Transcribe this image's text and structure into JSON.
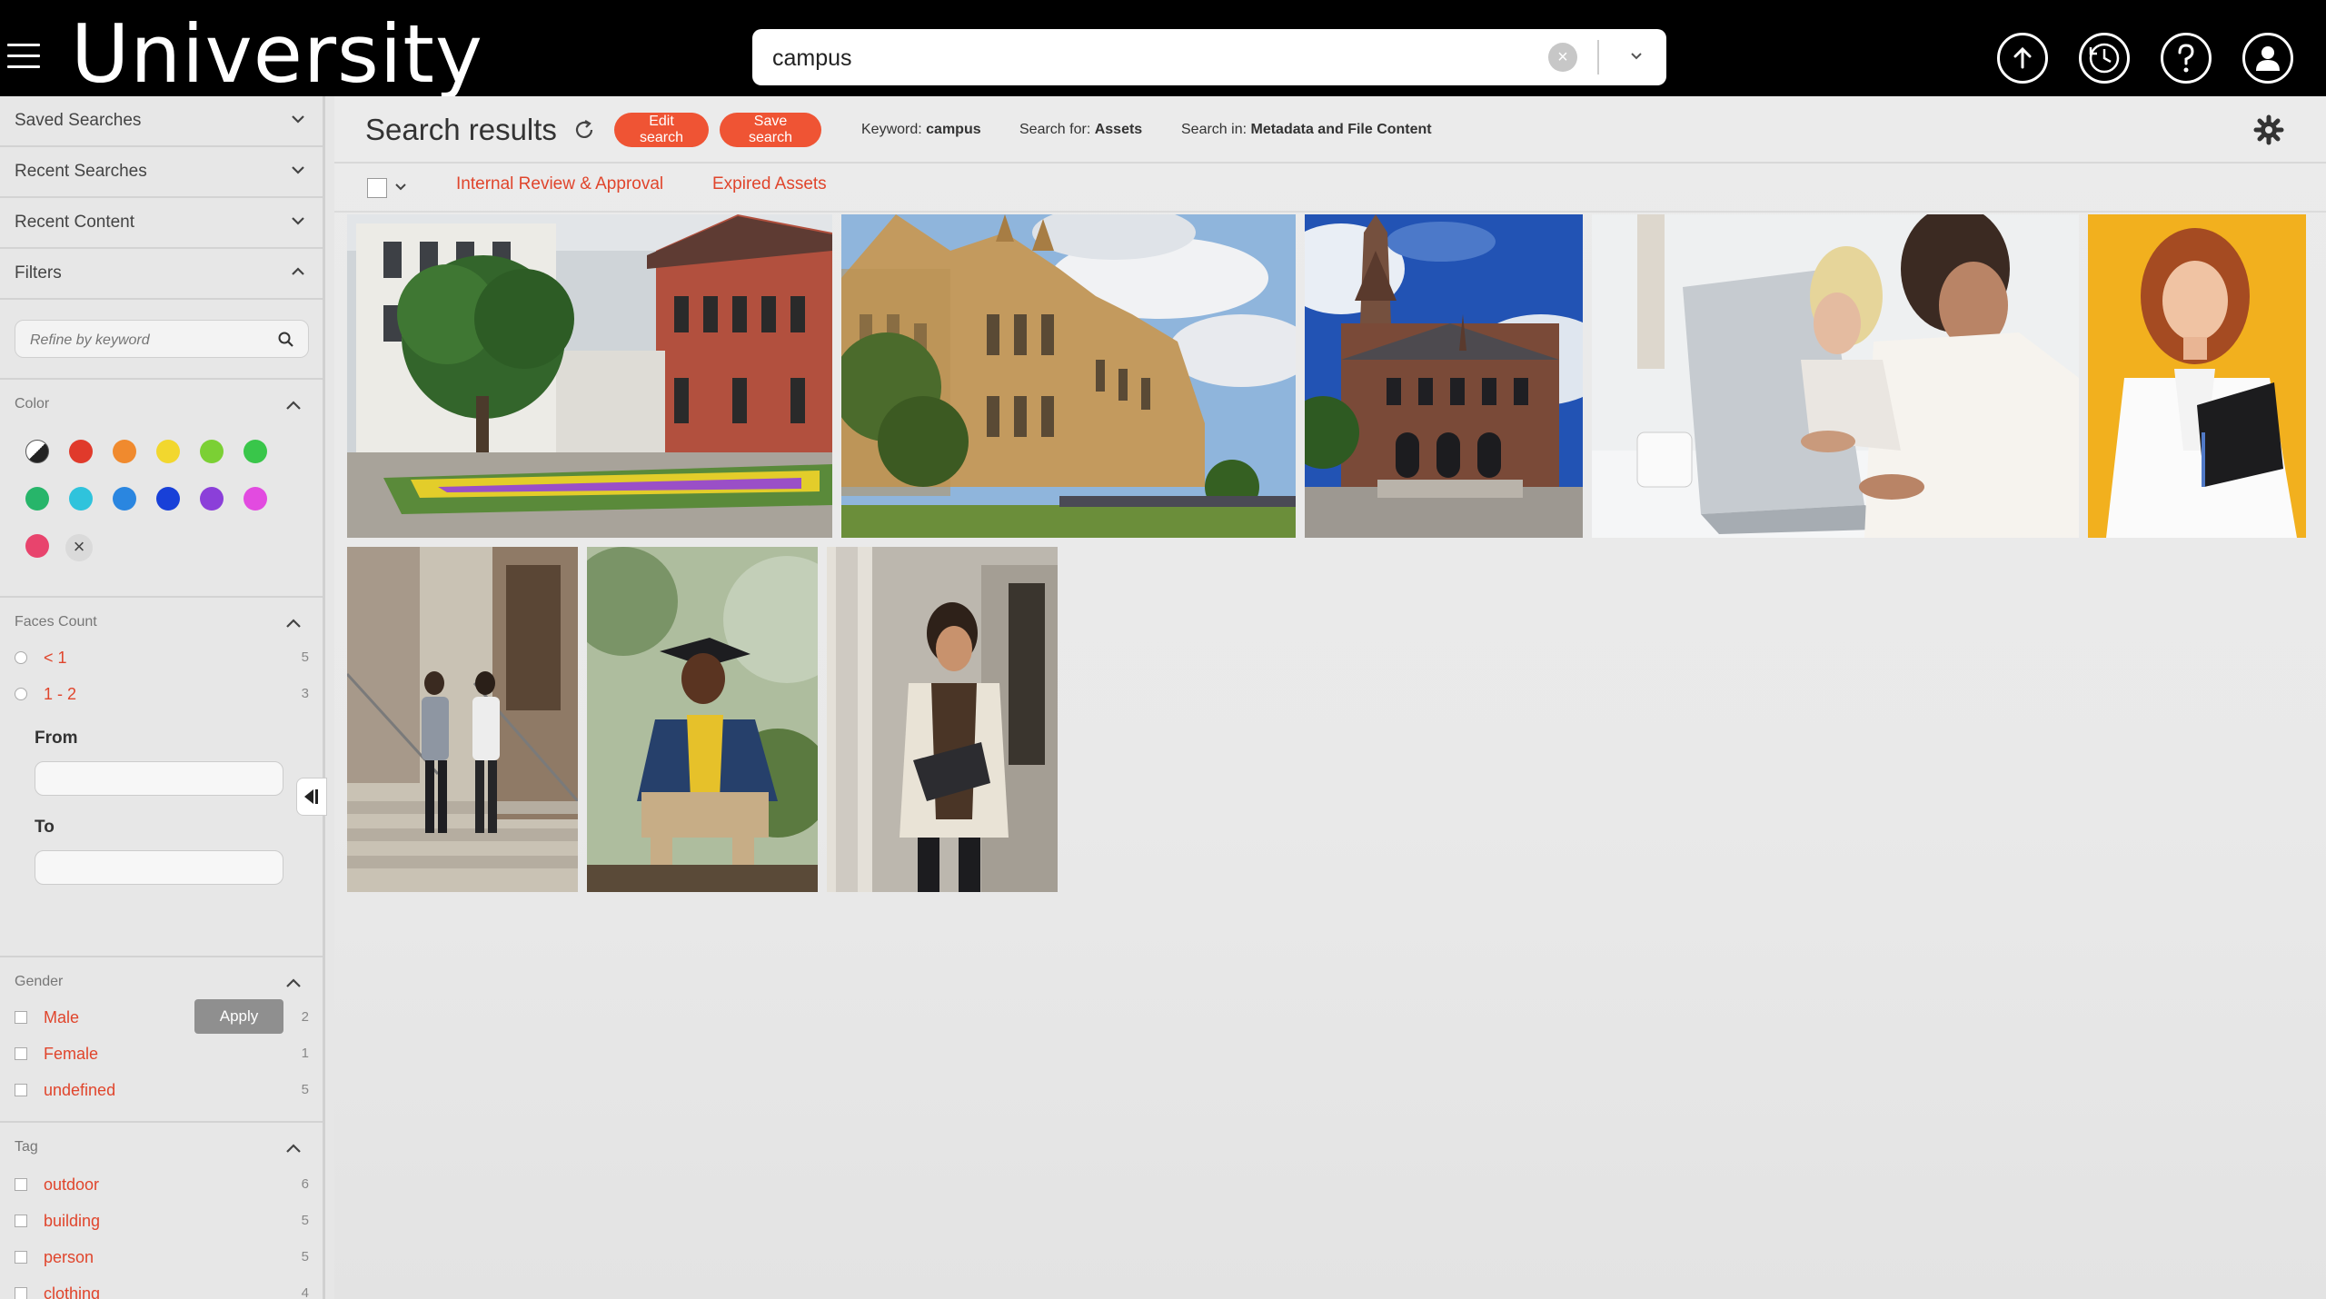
{
  "header": {
    "brand": "University",
    "search": {
      "value": "campus",
      "placeholder": ""
    },
    "icons": [
      "upload-icon",
      "history-icon",
      "help-icon",
      "user-icon"
    ]
  },
  "sidebar": {
    "sections": [
      {
        "label": "Saved Searches",
        "expanded": false
      },
      {
        "label": "Recent Searches",
        "expanded": false
      },
      {
        "label": "Recent Content",
        "expanded": false
      },
      {
        "label": "Filters",
        "expanded": true
      }
    ],
    "refine_placeholder": "Refine by keyword",
    "color": {
      "label": "Color",
      "swatches": [
        "#222222",
        "#e03a2b",
        "#f08a2e",
        "#f2d72e",
        "#7bd034",
        "#39c64a",
        "#27b56a",
        "#2fc3dc",
        "#2a86e0",
        "#1840d8",
        "#8b3fd9",
        "#e24be0",
        "#e8446d"
      ],
      "clear": "×"
    },
    "faces_count": {
      "label": "Faces Count",
      "items": [
        {
          "label": "< 1",
          "count": "5"
        },
        {
          "label": "1 - 2",
          "count": "3"
        }
      ],
      "from_label": "From",
      "to_label": "To",
      "apply_label": "Apply"
    },
    "gender": {
      "label": "Gender",
      "items": [
        {
          "label": "Male",
          "count": "2"
        },
        {
          "label": "Female",
          "count": "1"
        },
        {
          "label": "undefined",
          "count": "5"
        }
      ]
    },
    "tag": {
      "label": "Tag",
      "items": [
        {
          "label": "outdoor",
          "count": "6"
        },
        {
          "label": "building",
          "count": "5"
        },
        {
          "label": "person",
          "count": "5"
        },
        {
          "label": "clothing",
          "count": "4"
        }
      ]
    }
  },
  "main": {
    "title": "Search results",
    "edit_search": "Edit search",
    "save_search": "Save search",
    "keyword_label": "Keyword:",
    "keyword_value": "campus",
    "search_for_label": "Search for:",
    "search_for_value": "Assets",
    "search_in_label": "Search in:",
    "search_in_value": "Metadata and File Content",
    "tabs": [
      "Internal Review & Approval",
      "Expired Assets"
    ]
  },
  "colors": {
    "accent": "#ef5434",
    "link": "#e0452c",
    "topbar": "#000000"
  }
}
